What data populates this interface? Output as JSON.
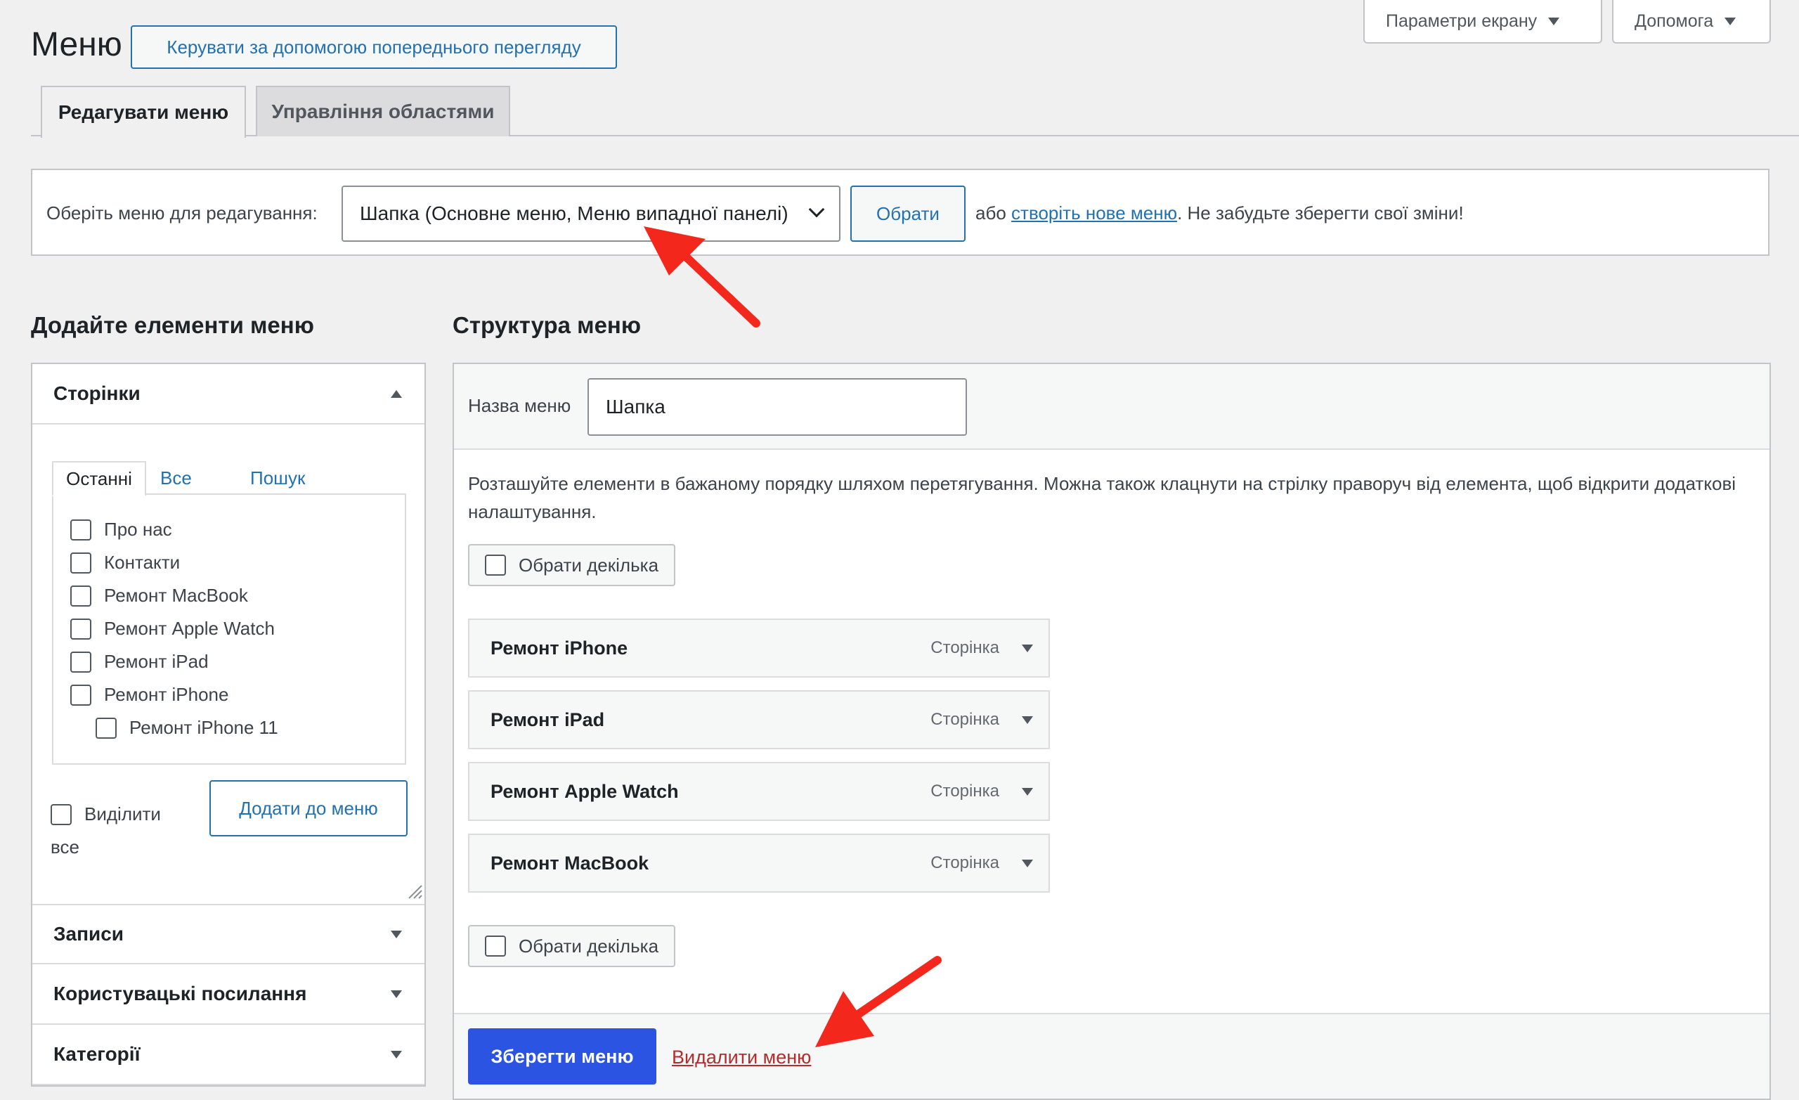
{
  "screen_options": {
    "label": "Параметри екрану"
  },
  "help": {
    "label": "Допомога"
  },
  "page": {
    "title": "Меню",
    "preview_button": "Керувати за допомогою попереднього перегляду"
  },
  "tabs": [
    {
      "label": "Редагувати меню",
      "active": true
    },
    {
      "label": "Управління областями",
      "active": false
    }
  ],
  "select_menu": {
    "label": "Оберіть меню для редагування:",
    "selected": "Шапка (Основне меню, Меню випадної панелі)",
    "select_button": "Обрати",
    "or_text": "або",
    "create_link": "створіть нове меню",
    "reminder": ". Не забудьте зберегти свої зміни!"
  },
  "add_items": {
    "title": "Додайте елементи меню",
    "pages": {
      "title": "Сторінки",
      "tabs": [
        "Останні",
        "Все",
        "Пошук"
      ],
      "items": [
        {
          "label": "Про нас",
          "indent": 0
        },
        {
          "label": "Контакти",
          "indent": 0
        },
        {
          "label": "Ремонт MacBook",
          "indent": 0
        },
        {
          "label": "Ремонт Apple Watch",
          "indent": 0
        },
        {
          "label": "Ремонт iPad",
          "indent": 0
        },
        {
          "label": "Ремонт iPhone",
          "indent": 0
        },
        {
          "label": "Ремонт iPhone 11",
          "indent": 1
        }
      ],
      "select_all_1": "Виділити",
      "select_all_2": "все",
      "add_button": "Додати до меню"
    },
    "sections": [
      "Записи",
      "Користувацькі посилання",
      "Категорії"
    ]
  },
  "structure": {
    "title": "Структура меню",
    "name_label": "Назва меню",
    "name_value": "Шапка",
    "description": "Розташуйте елементи в бажаному порядку шляхом перетягування. Можна також клацнути на стрілку праворуч від елемента, щоб відкрити додаткові налаштування.",
    "bulk_select": "Обрати декілька",
    "items": [
      {
        "title": "Ремонт iPhone",
        "type": "Сторінка"
      },
      {
        "title": "Ремонт iPad",
        "type": "Сторінка"
      },
      {
        "title": "Ремонт Apple Watch",
        "type": "Сторінка"
      },
      {
        "title": "Ремонт MacBook",
        "type": "Сторінка"
      }
    ],
    "save_button": "Зберегти меню",
    "delete_link": "Видалити меню"
  },
  "colors": {
    "accent": "#2271b1",
    "primary": "#2c54e3",
    "danger": "#b32d2e",
    "annotation_arrow": "#f4271c"
  }
}
